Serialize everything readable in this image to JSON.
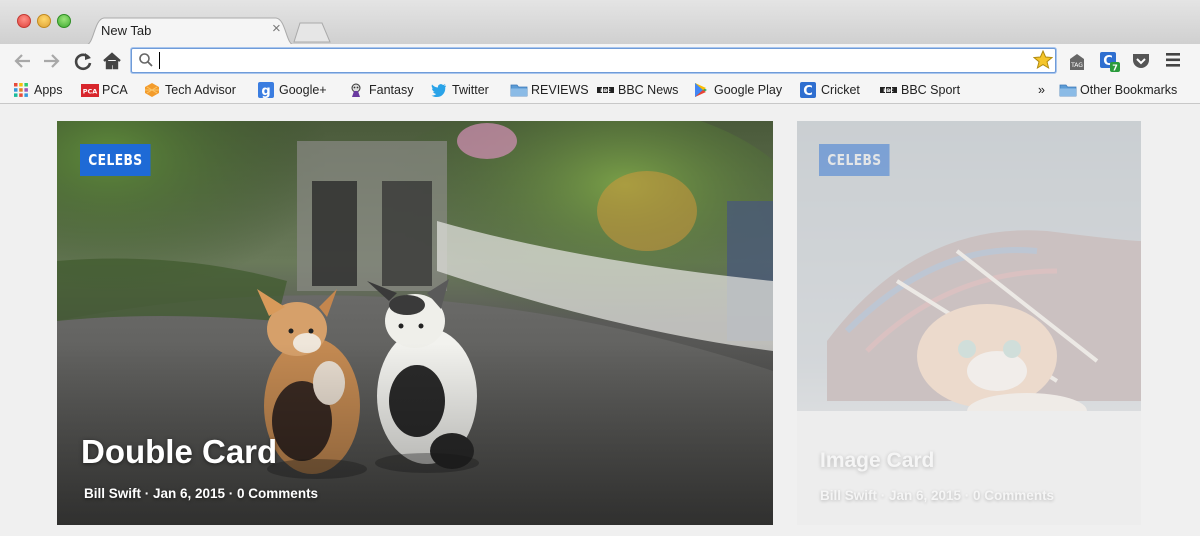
{
  "window": {
    "tab_title": "New Tab",
    "tab_close": "×"
  },
  "toolbar": {
    "url": "",
    "icons": [
      "back-arrow-icon",
      "forward-arrow-icon",
      "reload-icon",
      "home-icon",
      "search-icon",
      "star-icon",
      "tag-extension-icon",
      "c-extension-icon",
      "pocket-icon",
      "menu-icon"
    ],
    "extension_badge": "7"
  },
  "bookmarks": {
    "items": [
      {
        "label": "Apps"
      },
      {
        "label": "PCA"
      },
      {
        "label": "Tech Advisor"
      },
      {
        "label": "Google+"
      },
      {
        "label": "Fantasy"
      },
      {
        "label": "Twitter"
      },
      {
        "label": "REVIEWS"
      },
      {
        "label": "BBC News"
      },
      {
        "label": "Google Play"
      },
      {
        "label": "Cricket"
      },
      {
        "label": "BBC Sport"
      }
    ],
    "overflow": "»",
    "other": "Other Bookmarks",
    "pca_icon_text": "PCA",
    "g_icon_text": "g",
    "c_icon_text": "C",
    "bbc_icon_text": "BBC"
  },
  "cards": [
    {
      "category": "CELEBS",
      "title": "Double Card",
      "meta": "Bill Swift · Jan 6, 2015 · 0 Comments"
    },
    {
      "category": "CELEBS",
      "title": "Image Card",
      "meta": "Bill Swift · Jan 6, 2015 · 0 Comments"
    }
  ],
  "colors": {
    "accent": "#1e6ad6",
    "omnibox_focus": "#6f9bd8"
  }
}
